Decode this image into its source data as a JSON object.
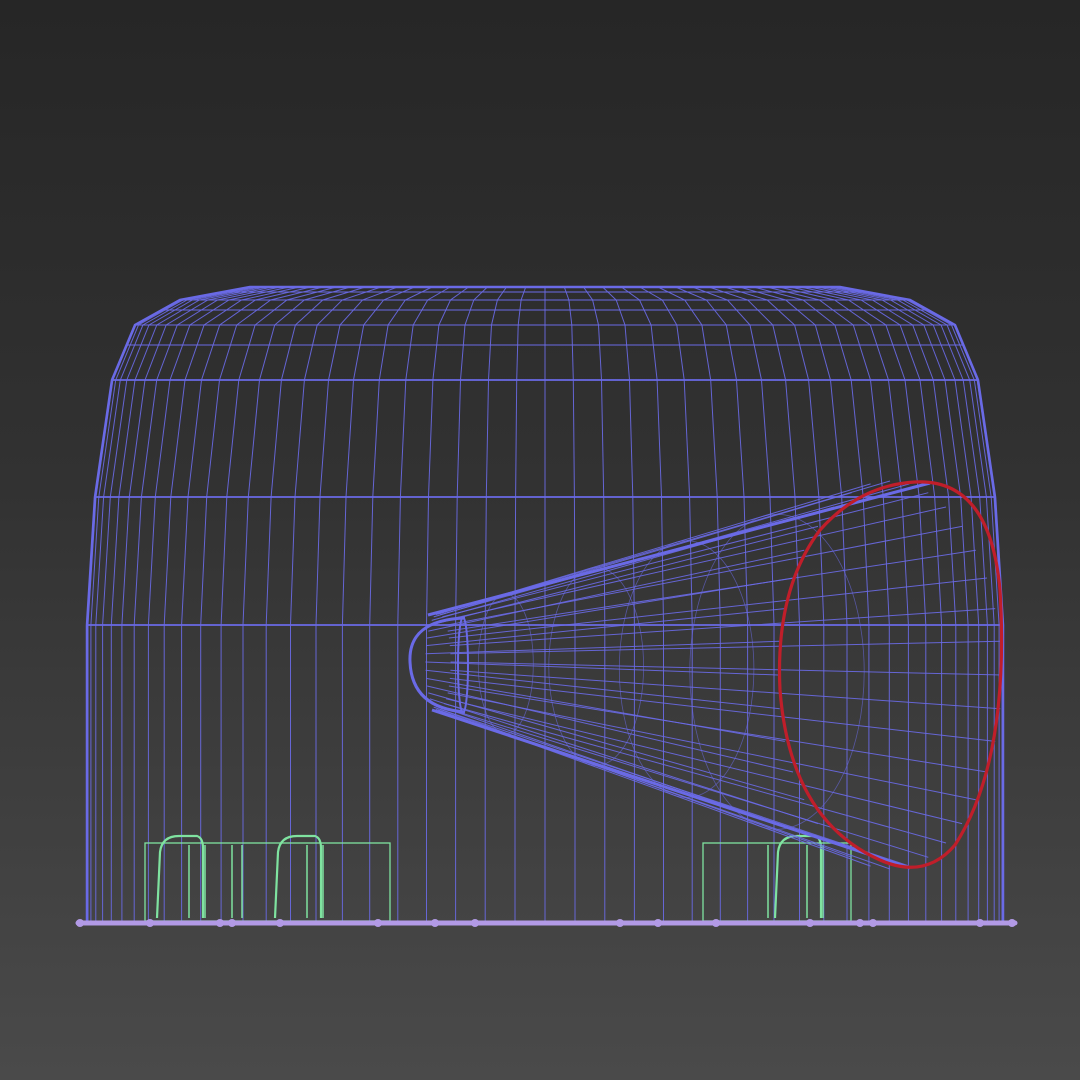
{
  "viewport": {
    "view": "front",
    "render_mode": "wireframe",
    "background": [
      "#262626",
      "#4a4a4a"
    ]
  },
  "objects": [
    {
      "id": "dome-shell",
      "kind": "capped cylinder shell",
      "color": "#6a6ae6"
    },
    {
      "id": "cone-horn",
      "kind": "cone",
      "color": "#6a6ae6"
    },
    {
      "id": "cone-opening-ring",
      "kind": "ellipse outline (selected)",
      "color": "#c01e2a"
    },
    {
      "id": "base-plate",
      "kind": "flat disc edge",
      "color": "#b29ae6"
    },
    {
      "id": "foot-left",
      "kind": "support block",
      "color": "#7fe3a0"
    },
    {
      "id": "foot-middle",
      "kind": "support block",
      "color": "#7fe3a0"
    },
    {
      "id": "foot-right",
      "kind": "support block",
      "color": "#7fe3a0"
    }
  ]
}
